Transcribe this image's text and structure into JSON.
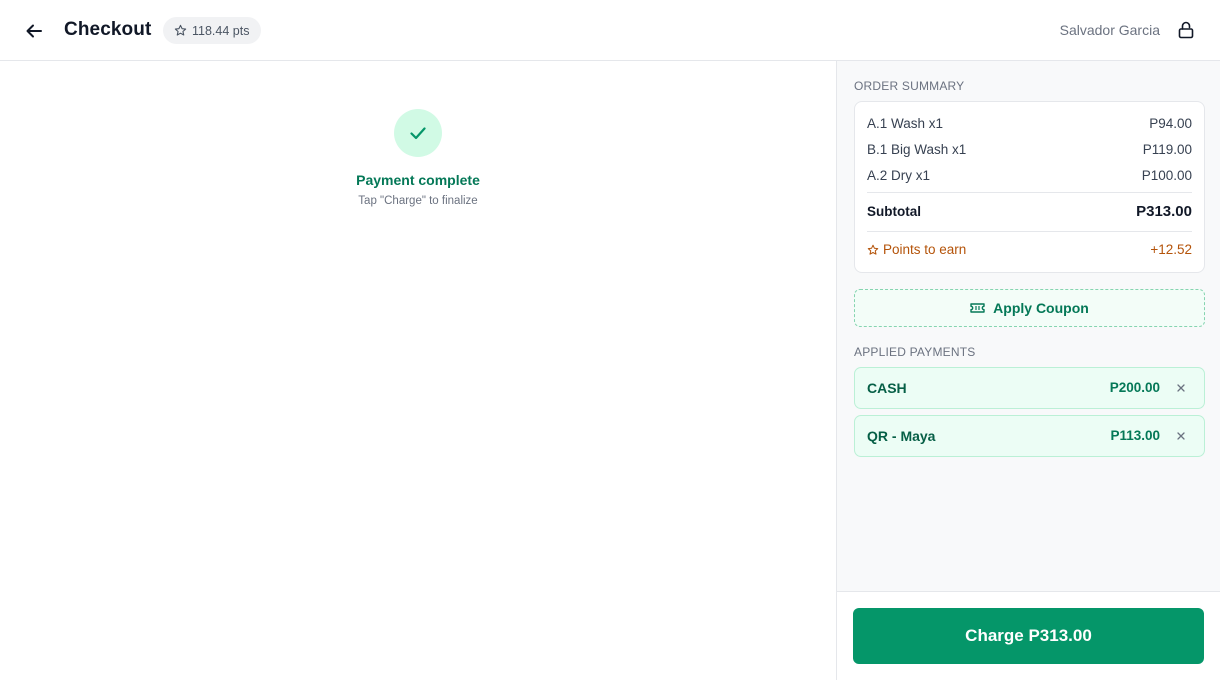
{
  "header": {
    "title": "Checkout",
    "points": "118.44 pts",
    "user_name": "Salvador Garcia"
  },
  "status": {
    "title": "Payment complete",
    "subtitle": "Tap \"Charge\" to finalize"
  },
  "order_summary": {
    "label": "ORDER SUMMARY",
    "items": [
      {
        "name": "A.1 Wash x1",
        "price": "P94.00"
      },
      {
        "name": "B.1 Big Wash x1",
        "price": "P119.00"
      },
      {
        "name": "A.2 Dry x1",
        "price": "P100.00"
      }
    ],
    "subtotal_label": "Subtotal",
    "subtotal_value": "P313.00",
    "points_label": "Points to earn",
    "points_value": "+12.52"
  },
  "coupon": {
    "label": "Apply Coupon"
  },
  "payments": {
    "label": "APPLIED PAYMENTS",
    "items": [
      {
        "name": "CASH",
        "amount": "P200.00"
      },
      {
        "name": "QR - Maya",
        "amount": "P113.00"
      }
    ]
  },
  "charge": {
    "label": "Charge P313.00"
  },
  "colors": {
    "accent": "#059669",
    "success_bg": "#d1fae5",
    "points": "#b45309"
  },
  "icons": [
    "arrow-left-icon",
    "star-icon",
    "lock-icon",
    "check-icon",
    "ticket-icon",
    "close-icon"
  ]
}
